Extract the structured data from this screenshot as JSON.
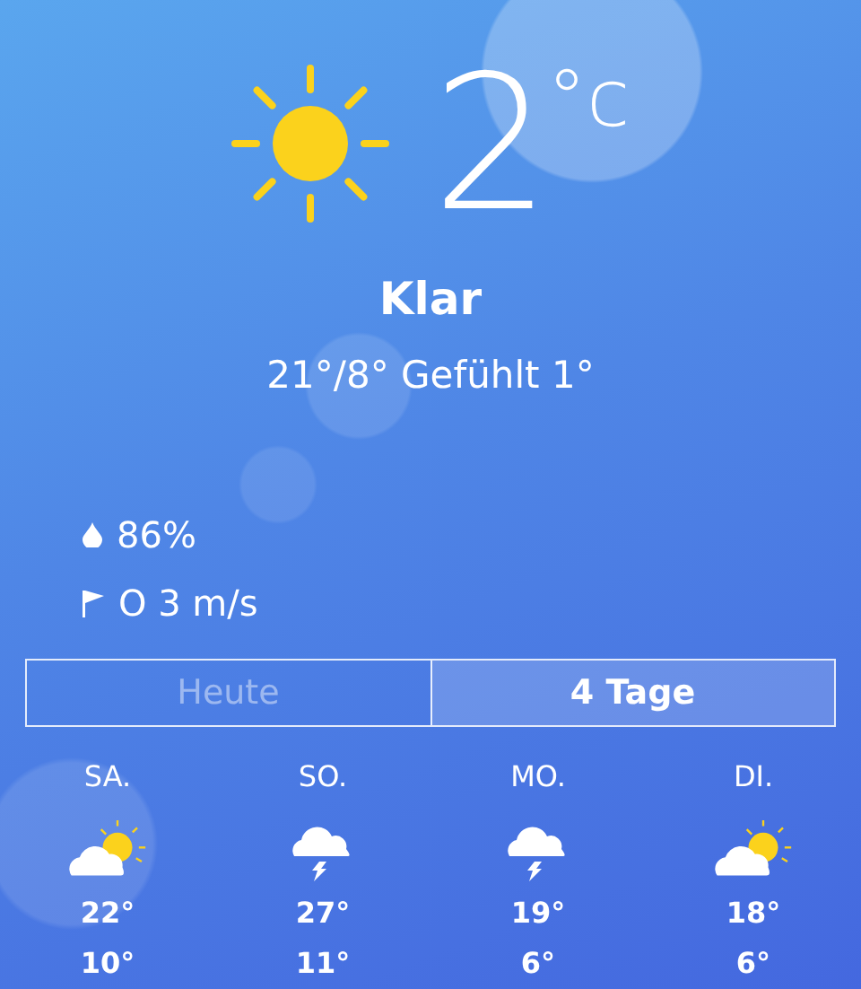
{
  "current": {
    "kind": "sunny",
    "temperature": "2",
    "unit": "°c",
    "condition": "Klar",
    "range": "21°/8° Gefühlt 1°"
  },
  "humidity": "86%",
  "wind": "O 3 m/s",
  "tabs": [
    {
      "label": "Heute",
      "selected": false
    },
    {
      "label": "4 Tage",
      "selected": true
    }
  ],
  "forecast": [
    {
      "day": "SA.",
      "kind": "partly-sunny",
      "high": "22°",
      "low": "10°"
    },
    {
      "day": "SO.",
      "kind": "thunder",
      "high": "27°",
      "low": "11°"
    },
    {
      "day": "MO.",
      "kind": "thunder",
      "high": "19°",
      "low": "6°"
    },
    {
      "day": "DI.",
      "kind": "partly-sunny",
      "high": "18°",
      "low": "6°"
    }
  ]
}
